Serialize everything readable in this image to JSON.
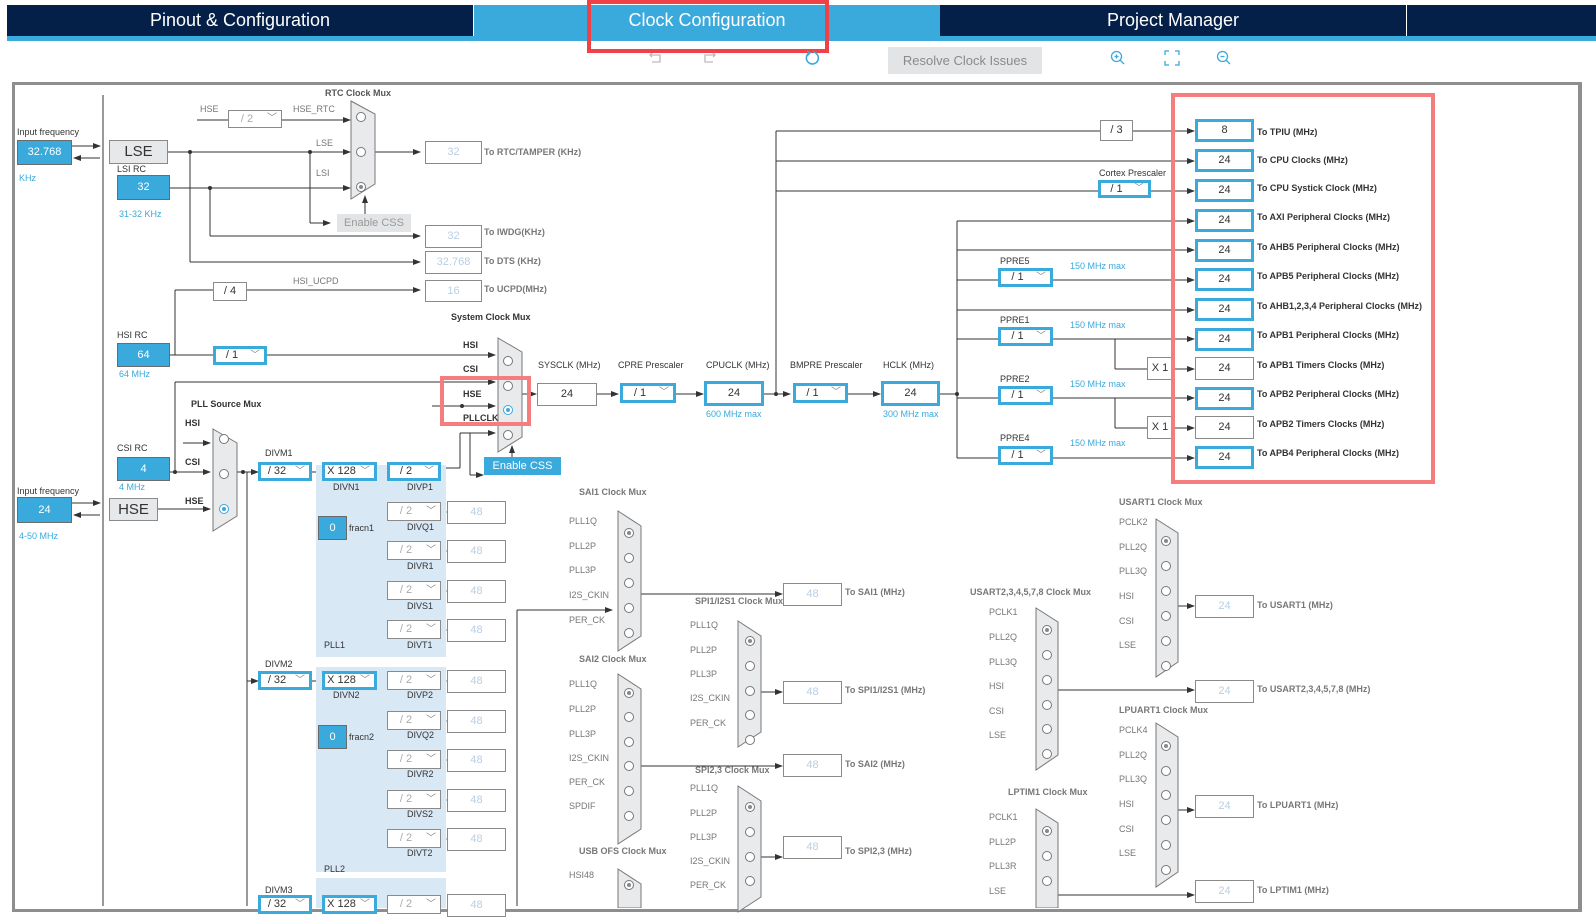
{
  "tabs": [
    {
      "label": "Pinout & Configuration",
      "active": false
    },
    {
      "label": "Clock Configuration",
      "active": true
    },
    {
      "label": "Project Manager",
      "active": false
    }
  ],
  "toolbar": {
    "undo_icon": "undo-icon",
    "redo_icon": "redo-icon",
    "reset_icon": "refresh-icon",
    "resolve_label": "Resolve Clock Issues",
    "zoom_in_icon": "zoom-in-icon",
    "fit_icon": "fit-screen-icon",
    "zoom_out_icon": "zoom-out-icon"
  },
  "colors": {
    "accent": "#3aa9dc",
    "header": "#042049",
    "highlight": "#f04048"
  },
  "sources": {
    "lse": {
      "label": "LSE",
      "input_label": "Input frequency",
      "value": "32.768",
      "unit": "KHz"
    },
    "lsi": {
      "label": "LSI RC",
      "value": "32",
      "range": "31-32 KHz"
    },
    "hsi": {
      "label": "HSI RC",
      "value": "64",
      "range": "64 MHz"
    },
    "csi": {
      "label": "CSI RC",
      "value": "4",
      "range": "4 MHz"
    },
    "hse": {
      "label": "HSE",
      "input_label": "Input frequency",
      "value": "24",
      "range": "4-50 MHz"
    }
  },
  "rtc": {
    "title": "RTC Clock Mux",
    "hse_label": "HSE",
    "hse_div": "/ 2",
    "hse_rtc_label": "HSE_RTC",
    "lse_label": "LSE",
    "lsi_label": "LSI",
    "enable_css": "Enable CSS",
    "out_rtc": {
      "value": "32",
      "label": "To RTC/TAMPER (KHz)"
    },
    "out_iwdg": {
      "value": "32",
      "label": "To IWDG(KHz)"
    },
    "out_dts": {
      "value": "32.768",
      "label": "To DTS (KHz)"
    },
    "ucpd_div": "/ 4",
    "ucpd_label": "HSI_UCPD",
    "out_ucpd": {
      "value": "16",
      "label": "To UCPD(MHz)"
    }
  },
  "hsi_div": "/ 1",
  "sysmux": {
    "title": "System Clock Mux",
    "inputs": [
      "HSI",
      "CSI",
      "HSE",
      "PLLCLK"
    ],
    "selected": 2,
    "enable_css": "Enable CSS"
  },
  "pllsrc": {
    "title": "PLL Source Mux",
    "inputs": [
      "HSI",
      "CSI",
      "HSE"
    ],
    "selected": 2
  },
  "chain": {
    "sysclk_label": "SYSCLK (MHz)",
    "sysclk": "24",
    "cpre_label": "CPRE Prescaler",
    "cpre": "/ 1",
    "cpuclk_label": "CPUCLK (MHz)",
    "cpuclk": "24",
    "cpuclk_max": "600 MHz max",
    "bmpre_label": "BMPRE Prescaler",
    "bmpre": "/ 1",
    "hclk_label": "HCLK (MHz)",
    "hclk": "24",
    "hclk_max": "300 MHz max"
  },
  "bus": {
    "tpiu_div": "/ 3",
    "cortex_label": "Cortex Prescaler",
    "cortex": "/ 1",
    "ppre5": {
      "label": "PPRE5",
      "value": "/ 1",
      "max": "150 MHz max"
    },
    "ppre1": {
      "label": "PPRE1",
      "value": "/ 1",
      "max": "150 MHz max"
    },
    "ppre2": {
      "label": "PPRE2",
      "value": "/ 1",
      "max": "150 MHz max"
    },
    "ppre4": {
      "label": "PPRE4",
      "value": "/ 1",
      "max": "150 MHz max"
    },
    "timx1": "X 1",
    "timx2": "X 1",
    "outputs": [
      {
        "value": "8",
        "label": "To TPIU (MHz)"
      },
      {
        "value": "24",
        "label": "To CPU Clocks (MHz)"
      },
      {
        "value": "24",
        "label": "To CPU Systick Clock (MHz)"
      },
      {
        "value": "24",
        "label": "To AXI Peripheral Clocks (MHz)"
      },
      {
        "value": "24",
        "label": "To AHB5 Peripheral Clocks  (MHz)"
      },
      {
        "value": "24",
        "label": "To APB5 Peripheral Clocks (MHz)"
      },
      {
        "value": "24",
        "label": "To AHB1,2,3,4 Peripheral Clocks (MHz)"
      },
      {
        "value": "24",
        "label": "To APB1 Peripheral Clocks (MHz)"
      },
      {
        "value": "24",
        "label": "To APB1 Timers Clocks (MHz)"
      },
      {
        "value": "24",
        "label": "To APB2 Peripheral Clocks (MHz)"
      },
      {
        "value": "24",
        "label": "To APB2 Timers Clocks (MHz)"
      },
      {
        "value": "24",
        "label": "To APB4 Peripheral Clocks (MHz)"
      }
    ]
  },
  "pll1": {
    "name": "PLL1",
    "divm_label": "DIVM1",
    "divm": "/ 32",
    "divn": "X 128",
    "divn_label": "DIVN1",
    "frac": "0",
    "frac_label": "fracn1",
    "divp": "/ 2",
    "divp_label": "DIVP1",
    "outs": [
      {
        "div": "/ 2",
        "label": "DIVQ1",
        "value": "48"
      },
      {
        "div": "/ 2",
        "label": "DIVR1",
        "value": "48"
      },
      {
        "div": "/ 2",
        "label": "DIVS1",
        "value": "48"
      },
      {
        "div": "/ 2",
        "label": "DIVT1",
        "value": "48"
      }
    ]
  },
  "pll2": {
    "name": "PLL2",
    "divm_label": "DIVM2",
    "divm": "/ 32",
    "divn": "X 128",
    "divn_label": "DIVN2",
    "frac": "0",
    "frac_label": "fracn2",
    "outs": [
      {
        "div": "/ 2",
        "label": "DIVP2",
        "value": "48"
      },
      {
        "div": "/ 2",
        "label": "DIVQ2",
        "value": "48"
      },
      {
        "div": "/ 2",
        "label": "DIVR2",
        "value": "48"
      },
      {
        "div": "/ 2",
        "label": "DIVS2",
        "value": "48"
      },
      {
        "div": "/ 2",
        "label": "DIVT2",
        "value": "48"
      }
    ]
  },
  "pll3": {
    "divm_label": "DIVM3",
    "divm": "/ 32",
    "divn": "X 128",
    "div": "/ 2",
    "value": "48"
  },
  "periph": {
    "sai1": {
      "title": "SAI1 Clock Mux",
      "inputs": [
        "PLL1Q",
        "PLL2P",
        "PLL3P",
        "I2S_CKIN",
        "PER_CK"
      ],
      "out": {
        "value": "48",
        "label": "To SAI1 (MHz)"
      }
    },
    "spi1": {
      "title": "SPI1/I2S1 Clock Mux",
      "inputs": [
        "PLL1Q",
        "PLL2P",
        "PLL3P",
        "I2S_CKIN",
        "PER_CK"
      ],
      "out": {
        "value": "48",
        "label": "To SPI1/I2S1 (MHz)"
      }
    },
    "sai2": {
      "title": "SAI2 Clock Mux",
      "inputs": [
        "PLL1Q",
        "PLL2P",
        "PLL3P",
        "I2S_CKIN",
        "PER_CK",
        "SPDIF"
      ],
      "out": {
        "value": "48",
        "label": "To SAI2 (MHz)"
      }
    },
    "spi23": {
      "title": "SPI2,3 Clock Mux",
      "inputs": [
        "PLL1Q",
        "PLL2P",
        "PLL3P",
        "I2S_CKIN",
        "PER_CK"
      ],
      "out": {
        "value": "48",
        "label": "To SPI2,3 (MHz)"
      }
    },
    "usb": {
      "title": "USB OFS Clock Mux",
      "inputs": [
        "HSI48"
      ]
    },
    "usart1": {
      "title": "USART1 Clock Mux",
      "inputs": [
        "PCLK2",
        "PLL2Q",
        "PLL3Q",
        "HSI",
        "CSI",
        "LSE"
      ],
      "out": {
        "value": "24",
        "label": "To USART1 (MHz)"
      }
    },
    "usart2": {
      "title": "USART2,3,4,5,7,8 Clock Mux",
      "inputs": [
        "PCLK1",
        "PLL2Q",
        "PLL3Q",
        "HSI",
        "CSI",
        "LSE"
      ],
      "out": {
        "value": "24",
        "label": "To USART2,3,4,5,7,8 (MHz)"
      }
    },
    "lpuart1": {
      "title": "LPUART1 Clock Mux",
      "inputs": [
        "PCLK4",
        "PLL2Q",
        "PLL3Q",
        "HSI",
        "CSI",
        "LSE"
      ],
      "out": {
        "value": "24",
        "label": "To LPUART1 (MHz)"
      }
    },
    "lptim1": {
      "title": "LPTIM1 Clock Mux",
      "inputs": [
        "PCLK1",
        "PLL2P",
        "PLL3R",
        "LSE"
      ],
      "out": {
        "value": "24",
        "label": "To LPTIM1 (MHz)"
      }
    }
  }
}
